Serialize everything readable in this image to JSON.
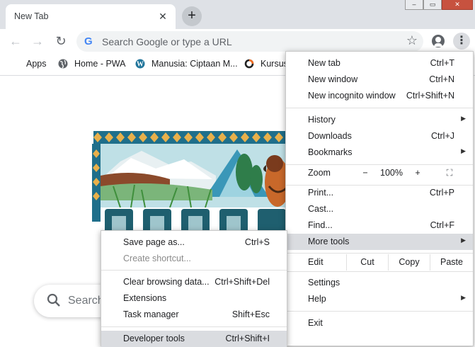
{
  "browser": {
    "tab_title": "New Tab",
    "tab_close": "✕",
    "new_tab": "+",
    "window_controls": [
      "‒",
      "▭",
      "✕"
    ]
  },
  "toolbar": {
    "search_placeholder": "Search Google or type a URL",
    "back_icon": "←",
    "forward_icon": "→",
    "reload_icon": "↻",
    "star_icon": "☆",
    "menu_icon": "⋮",
    "g_letter": "G"
  },
  "bookmarks": [
    {
      "label": "Apps",
      "icon": "apps-grid-icon"
    },
    {
      "label": "Home - PWA",
      "icon": "globe-icon"
    },
    {
      "label": "Manusia: Ciptaan M...",
      "icon": "wordpress-icon"
    },
    {
      "label": "Kursus",
      "icon": "ring-icon"
    }
  ],
  "page": {
    "search_placeholder": "Search"
  },
  "main_menu": {
    "new_tab": {
      "label": "New tab",
      "shortcut": "Ctrl+T"
    },
    "new_window": {
      "label": "New window",
      "shortcut": "Ctrl+N"
    },
    "new_incognito": {
      "label": "New incognito window",
      "shortcut": "Ctrl+Shift+N"
    },
    "history": {
      "label": "History"
    },
    "downloads": {
      "label": "Downloads",
      "shortcut": "Ctrl+J"
    },
    "bookmarks": {
      "label": "Bookmarks"
    },
    "zoom": {
      "label": "Zoom",
      "minus": "−",
      "value": "100%",
      "plus": "+",
      "fullscreen": "⛶"
    },
    "print": {
      "label": "Print...",
      "shortcut": "Ctrl+P"
    },
    "cast": {
      "label": "Cast..."
    },
    "find": {
      "label": "Find...",
      "shortcut": "Ctrl+F"
    },
    "more_tools": {
      "label": "More tools"
    },
    "edit": {
      "label": "Edit",
      "cut": "Cut",
      "copy": "Copy",
      "paste": "Paste"
    },
    "settings": {
      "label": "Settings"
    },
    "help": {
      "label": "Help"
    },
    "exit": {
      "label": "Exit"
    }
  },
  "more_tools_menu": {
    "save_page": {
      "label": "Save page as...",
      "shortcut": "Ctrl+S"
    },
    "create_shortcut": {
      "label": "Create shortcut..."
    },
    "clear_data": {
      "label": "Clear browsing data...",
      "shortcut": "Ctrl+Shift+Del"
    },
    "extensions": {
      "label": "Extensions"
    },
    "task_manager": {
      "label": "Task manager",
      "shortcut": "Shift+Esc"
    },
    "dev_tools": {
      "label": "Developer tools",
      "shortcut": "Ctrl+Shift+I"
    }
  },
  "colors": {
    "tabstrip": "#dee1e6",
    "menu_highlight": "#dadce0",
    "accent_blue": "#4285f4"
  }
}
